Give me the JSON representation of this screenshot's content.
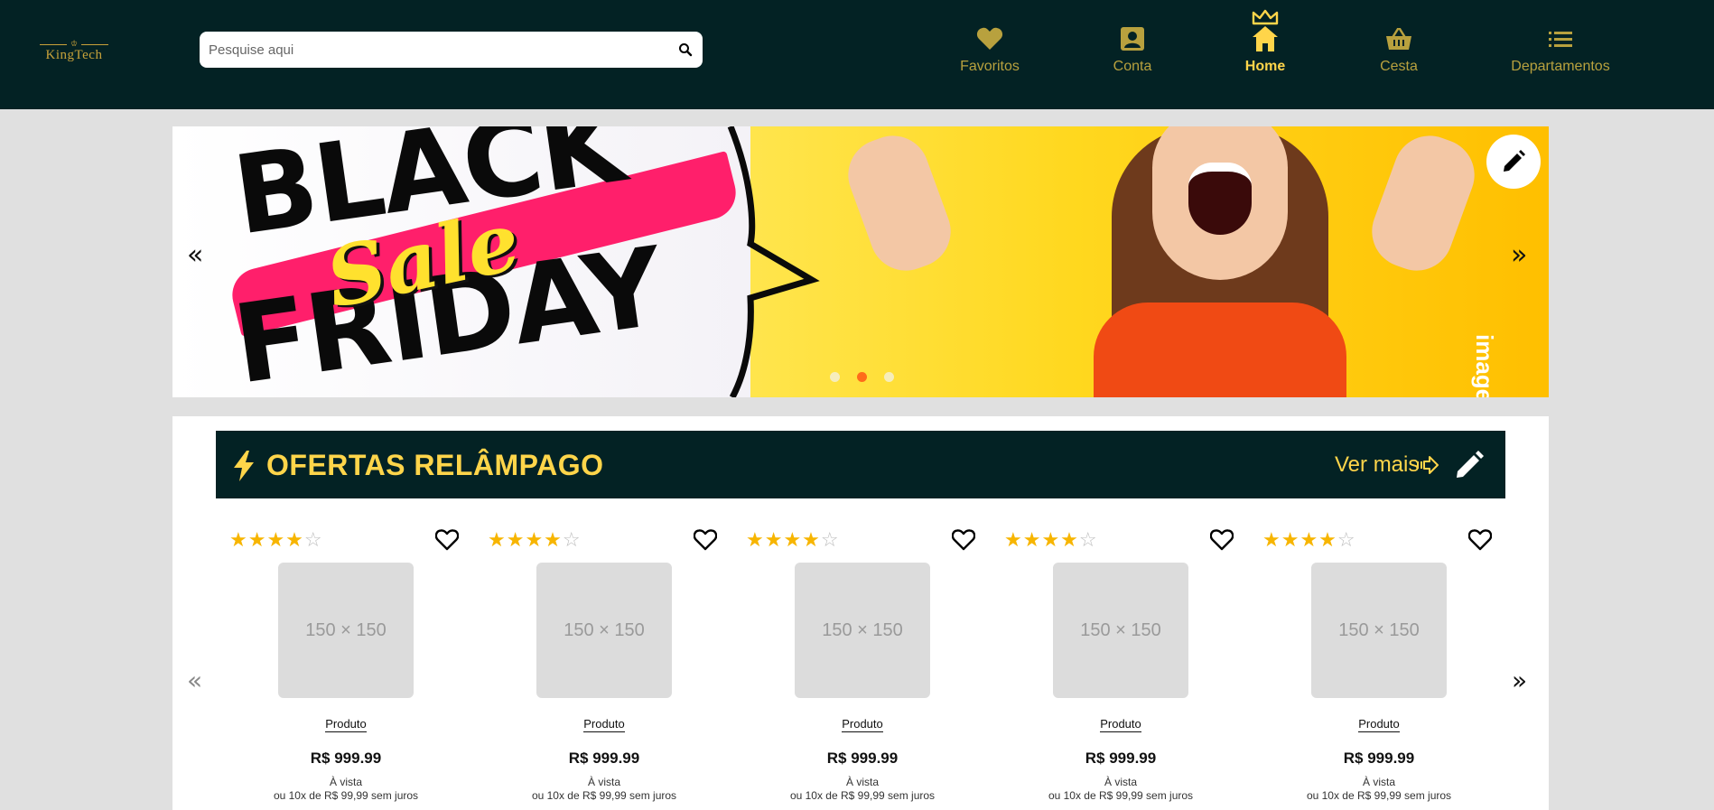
{
  "header": {
    "logo_text": "KingTech",
    "logo_crown": "♔",
    "search_placeholder": "Pesquise aqui",
    "nav": [
      {
        "label": "Favoritos",
        "icon": "heart-icon"
      },
      {
        "label": "Conta",
        "icon": "account-icon"
      },
      {
        "label": "Home",
        "icon": "home-crown-icon",
        "active": true
      },
      {
        "label": "Cesta",
        "icon": "basket-icon"
      },
      {
        "label": "Departamentos",
        "icon": "list-icon"
      }
    ]
  },
  "banner": {
    "headline_top": "BLACK",
    "headline_middle": "Sale",
    "headline_bottom": "FRIDAY",
    "side_text": "image",
    "prev_arrow": "«",
    "next_arrow": "»",
    "slide_count": 3,
    "active_slide": 1
  },
  "offers": {
    "title": "OFERTAS RELÂMPAGO",
    "see_more": "Ver mais",
    "prev_arrow": "«",
    "next_arrow": "»",
    "products": [
      {
        "rating": 4,
        "image": "150 × 150",
        "name": "Produto",
        "price": "R$ 999.99",
        "cash": "À vista",
        "installments": "ou 10x de R$ 99,99 sem juros"
      },
      {
        "rating": 4,
        "image": "150 × 150",
        "name": "Produto",
        "price": "R$ 999.99",
        "cash": "À vista",
        "installments": "ou 10x de R$ 99,99 sem juros"
      },
      {
        "rating": 4,
        "image": "150 × 150",
        "name": "Produto",
        "price": "R$ 999.99",
        "cash": "À vista",
        "installments": "ou 10x de R$ 99,99 sem juros"
      },
      {
        "rating": 4,
        "image": "150 × 150",
        "name": "Produto",
        "price": "R$ 999.99",
        "cash": "À vista",
        "installments": "ou 10x de R$ 99,99 sem juros"
      },
      {
        "rating": 4,
        "image": "150 × 150",
        "name": "Produto",
        "price": "R$ 999.99",
        "cash": "À vista",
        "installments": "ou 10x de R$ 99,99 sem juros"
      }
    ]
  },
  "colors": {
    "header_bg": "#032224",
    "accent_gold": "#ffd54a",
    "nav_text": "#b8a13e",
    "star": "#f7b500"
  }
}
